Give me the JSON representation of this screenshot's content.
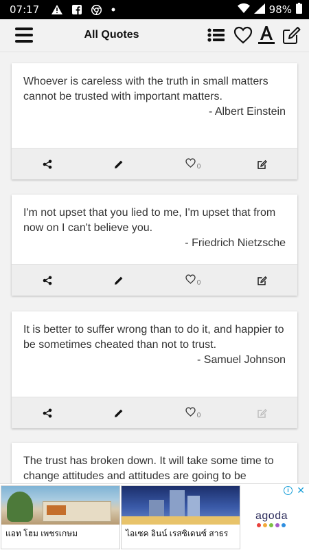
{
  "status_bar": {
    "time": "07:17",
    "icons": [
      "alert-icon",
      "facebook-icon",
      "chrome-icon",
      "dot-icon"
    ],
    "battery": "98%"
  },
  "app_bar": {
    "title": "All Quotes",
    "actions": [
      "list-icon",
      "heart-icon",
      "font-icon",
      "edit-icon"
    ]
  },
  "quotes": [
    {
      "text": "Whoever is careless with the truth in small matters cannot be trusted with important matters.",
      "author": "- Albert Einstein",
      "likes": "0"
    },
    {
      "text": "I'm not upset that you lied to me, I'm upset that from now on I can't believe you.",
      "author": "- Friedrich Nietzsche",
      "likes": "0"
    },
    {
      "text": "It is better to suffer wrong than to do it, and happier to be sometimes cheated than not to trust.",
      "author": "- Samuel Johnson",
      "likes": "0"
    },
    {
      "text": "The trust has broken down. It will take some time to change attitudes and attitudes are going to be",
      "author": "",
      "likes": ""
    }
  ],
  "ad": {
    "tile1_caption": "แอท โฮม เพชรเกษม",
    "tile2_caption": "ไอเซค อินน์ เรสซิเดนซ์ สาธร",
    "brand": "agoda",
    "colors": {
      "accent": "#1a9fd8"
    }
  }
}
